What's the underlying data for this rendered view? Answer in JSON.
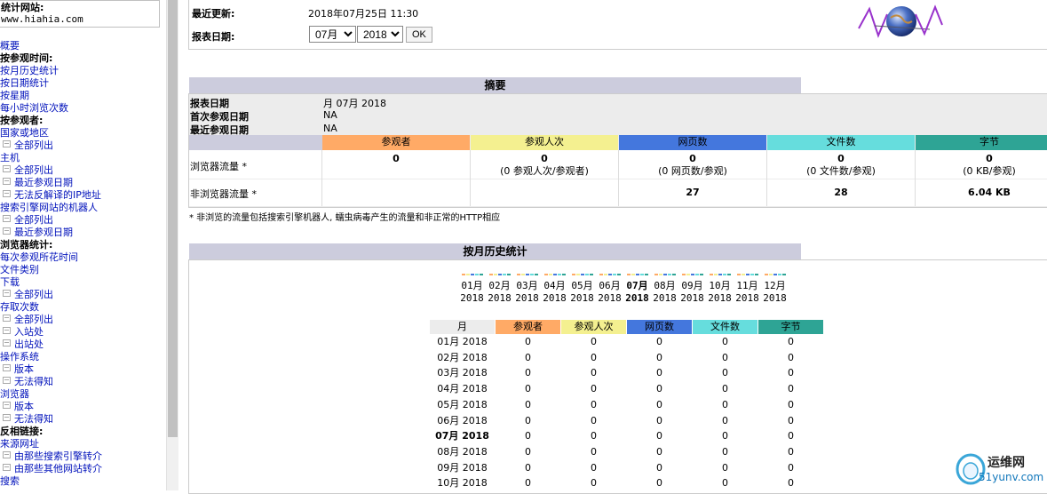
{
  "menu": {
    "site_label": "统计网站:",
    "site_value": "www.hiahia.com",
    "items": [
      {
        "label": "概要",
        "type": "link"
      },
      {
        "label": "按参观时间:",
        "type": "hd"
      },
      {
        "label": "按月历史统计",
        "type": "link"
      },
      {
        "label": "按日期统计",
        "type": "link"
      },
      {
        "label": "按星期",
        "type": "link"
      },
      {
        "label": "每小时浏览次数",
        "type": "link"
      },
      {
        "label": "按参观者:",
        "type": "hd"
      },
      {
        "label": "国家或地区",
        "type": "link"
      },
      {
        "label": "全部列出",
        "type": "sub"
      },
      {
        "label": "主机",
        "type": "link"
      },
      {
        "label": "全部列出",
        "type": "sub"
      },
      {
        "label": "最近参观日期",
        "type": "sub"
      },
      {
        "label": "无法反解译的IP地址",
        "type": "sub"
      },
      {
        "label": "搜索引擎网站的机器人",
        "type": "link"
      },
      {
        "label": "全部列出",
        "type": "sub"
      },
      {
        "label": "最近参观日期",
        "type": "sub"
      },
      {
        "label": "浏览器统计:",
        "type": "hd"
      },
      {
        "label": "每次参观所花时间",
        "type": "link"
      },
      {
        "label": "文件类别",
        "type": "link"
      },
      {
        "label": "下载",
        "type": "link"
      },
      {
        "label": "全部列出",
        "type": "sub"
      },
      {
        "label": "存取次数",
        "type": "link"
      },
      {
        "label": "全部列出",
        "type": "sub"
      },
      {
        "label": "入站处",
        "type": "sub"
      },
      {
        "label": "出站处",
        "type": "sub"
      },
      {
        "label": "操作系统",
        "type": "link"
      },
      {
        "label": "版本",
        "type": "sub"
      },
      {
        "label": "无法得知",
        "type": "sub"
      },
      {
        "label": "浏览器",
        "type": "link"
      },
      {
        "label": "版本",
        "type": "sub"
      },
      {
        "label": "无法得知",
        "type": "sub"
      },
      {
        "label": "反相链接:",
        "type": "hd"
      },
      {
        "label": "来源网址",
        "type": "link"
      },
      {
        "label": "由那些搜索引擎转介",
        "type": "sub"
      },
      {
        "label": "由那些其他网站转介",
        "type": "sub"
      },
      {
        "label": "搜索",
        "type": "link"
      }
    ]
  },
  "header": {
    "last_update_label": "最近更新:",
    "last_update_value": "2018年07月25日 11:30",
    "report_date_label": "报表日期:",
    "month_selected": "07月",
    "year_selected": "2018",
    "ok_label": "OK"
  },
  "summary": {
    "title": "摘要",
    "rows": [
      {
        "label": "报表日期",
        "value": "月 07月 2018"
      },
      {
        "label": "首次参观日期",
        "value": "NA"
      },
      {
        "label": "最近参观日期",
        "value": "NA"
      }
    ],
    "columns": [
      {
        "label": "参观者",
        "color": "#ffaa66"
      },
      {
        "label": "参观人次",
        "color": "#f4f090"
      },
      {
        "label": "网页数",
        "color": "#4477dd"
      },
      {
        "label": "文件数",
        "color": "#66dddd"
      },
      {
        "label": "字节",
        "color": "#2ea495"
      }
    ],
    "browser_label": "浏览器流量 *",
    "browser_values": [
      "0",
      "0",
      "0",
      "0",
      "0"
    ],
    "browser_sub": [
      "",
      "(0 参观人次/参观者)",
      "(0 网页数/参观)",
      "(0 文件数/参观)",
      "(0 KB/参观)"
    ],
    "nonbrowser_label": "非浏览器流量 *",
    "nonbrowser_values": [
      "",
      "",
      "27",
      "28",
      "6.04 KB"
    ],
    "footnote": "* 非浏览的流量包括搜索引擎机器人, 蠕虫病毒产生的流量和非正常的HTTP相应"
  },
  "monthly": {
    "title": "按月历史统计",
    "months": [
      {
        "m": "01月",
        "y": "2018"
      },
      {
        "m": "02月",
        "y": "2018"
      },
      {
        "m": "03月",
        "y": "2018"
      },
      {
        "m": "04月",
        "y": "2018"
      },
      {
        "m": "05月",
        "y": "2018"
      },
      {
        "m": "06月",
        "y": "2018"
      },
      {
        "m": "07月",
        "y": "2018",
        "current": true
      },
      {
        "m": "08月",
        "y": "2018"
      },
      {
        "m": "09月",
        "y": "2018"
      },
      {
        "m": "10月",
        "y": "2018"
      },
      {
        "m": "11月",
        "y": "2018"
      },
      {
        "m": "12月",
        "y": "2018"
      }
    ],
    "table_headers": [
      "月",
      "参观者",
      "参观人次",
      "网页数",
      "文件数",
      "字节"
    ],
    "rows": [
      {
        "month": "01月 2018",
        "values": [
          "0",
          "0",
          "0",
          "0",
          "0"
        ]
      },
      {
        "month": "02月 2018",
        "values": [
          "0",
          "0",
          "0",
          "0",
          "0"
        ]
      },
      {
        "month": "03月 2018",
        "values": [
          "0",
          "0",
          "0",
          "0",
          "0"
        ]
      },
      {
        "month": "04月 2018",
        "values": [
          "0",
          "0",
          "0",
          "0",
          "0"
        ]
      },
      {
        "month": "05月 2018",
        "values": [
          "0",
          "0",
          "0",
          "0",
          "0"
        ]
      },
      {
        "month": "06月 2018",
        "values": [
          "0",
          "0",
          "0",
          "0",
          "0"
        ]
      },
      {
        "month": "07月 2018",
        "values": [
          "0",
          "0",
          "0",
          "0",
          "0"
        ],
        "current": true
      },
      {
        "month": "08月 2018",
        "values": [
          "0",
          "0",
          "0",
          "0",
          "0"
        ]
      },
      {
        "month": "09月 2018",
        "values": [
          "0",
          "0",
          "0",
          "0",
          "0"
        ]
      },
      {
        "month": "10月 2018",
        "values": [
          "0",
          "0",
          "0",
          "0",
          "0"
        ]
      }
    ]
  },
  "watermark": {
    "brand": "运维网",
    "domain": "51yunv.com"
  }
}
